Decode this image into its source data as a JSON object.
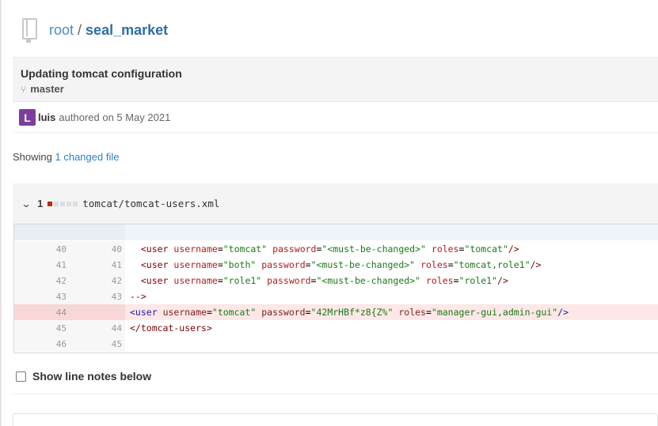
{
  "breadcrumb": {
    "root": "root",
    "separator": "/",
    "repo": "seal_market"
  },
  "commit": {
    "title": "Updating tomcat configuration",
    "branch": "master",
    "author_initial": "L",
    "author": "luis",
    "authored": "authored on 5 May 2021"
  },
  "summary": {
    "prefix": "Showing",
    "link": "1 changed file"
  },
  "file": {
    "change_count": "1",
    "path": "tomcat/tomcat-users.xml"
  },
  "diff_lines": [
    {
      "old": "40",
      "new": "40",
      "type": "context",
      "text": "  <user username=\"tomcat\" password=\"<must-be-changed>\" roles=\"tomcat\"/>"
    },
    {
      "old": "41",
      "new": "41",
      "type": "context",
      "text": "  <user username=\"both\" password=\"<must-be-changed>\" roles=\"tomcat,role1\"/>"
    },
    {
      "old": "42",
      "new": "42",
      "type": "context",
      "text": "  <user username=\"role1\" password=\"<must-be-changed>\" roles=\"role1\"/>"
    },
    {
      "old": "43",
      "new": "43",
      "type": "context",
      "text": "-->"
    },
    {
      "old": "44",
      "new": "",
      "type": "removed",
      "text": "<user username=\"tomcat\" password=\"42MrHBf*z8{Z%\" roles=\"manager-gui,admin-gui\"/>"
    },
    {
      "old": "45",
      "new": "44",
      "type": "context",
      "text": "</tomcat-users>"
    },
    {
      "old": "46",
      "new": "45",
      "type": "context",
      "text": ""
    }
  ],
  "options": {
    "show_line_notes": "Show line notes below"
  },
  "colors": {
    "link": "#2f80c8",
    "avatar": "#7b3ea0",
    "removed_bg": "#fde7e7",
    "deletion_bar": "#bd2c00"
  }
}
